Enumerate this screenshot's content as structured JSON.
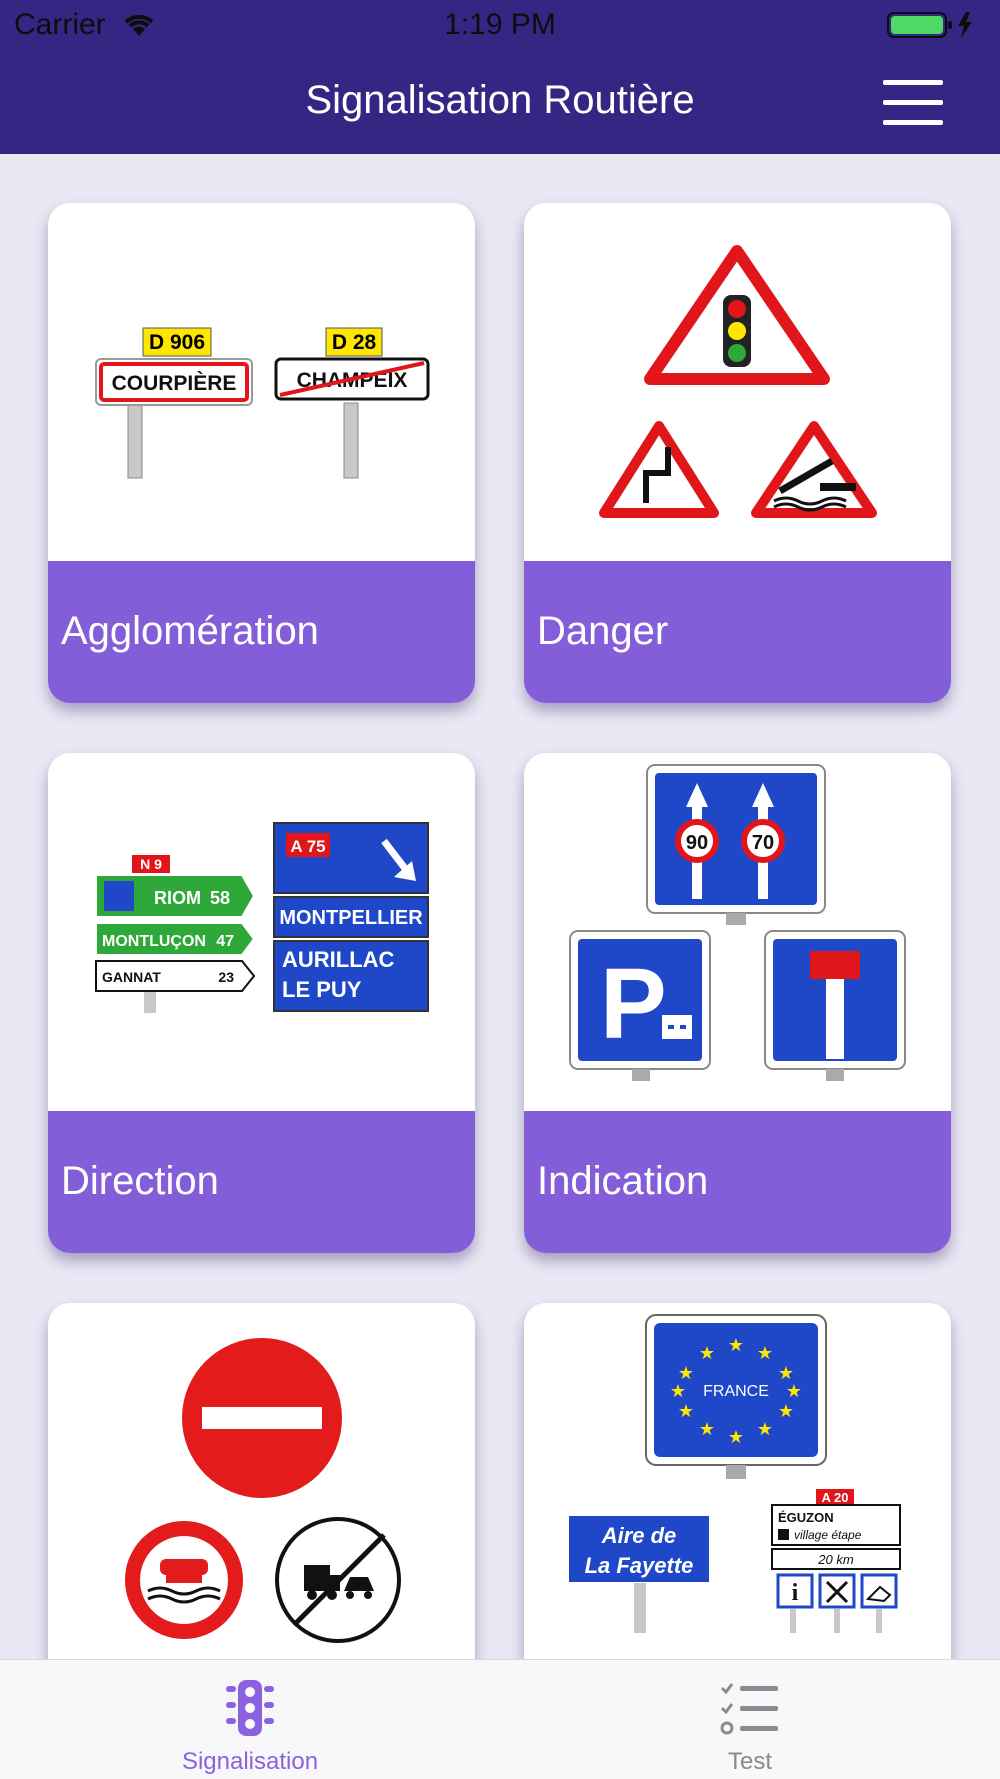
{
  "status_bar": {
    "carrier": "Carrier",
    "time": "1:19 PM"
  },
  "nav": {
    "title": "Signalisation Routière"
  },
  "cards": [
    {
      "label": "Agglomération"
    },
    {
      "label": "Danger"
    },
    {
      "label": "Direction"
    },
    {
      "label": "Indication"
    },
    {
      "label": ""
    },
    {
      "label": ""
    }
  ],
  "sign_text": {
    "agglo_road_1": "D 906",
    "agglo_town_1": "COURPIÈRE",
    "agglo_road_2": "D 28",
    "agglo_town_2": "CHAMPEIX",
    "dir_route": "N 9",
    "dir_city_1": "RIOM",
    "dir_dist_1": "58",
    "dir_city_2": "MONTLUÇON",
    "dir_dist_2": "47",
    "dir_city_3": "GANNAT",
    "dir_dist_3": "23",
    "dir_motorway": "A 75",
    "dir_city_4": "MONTPELLIER",
    "dir_city_5": "AURILLAC",
    "dir_city_6": "LE PUY",
    "ind_speed_1": "90",
    "ind_speed_2": "70",
    "loc_country": "FRANCE",
    "loc_aire_1": "Aire de",
    "loc_aire_2": "La Fayette",
    "loc_motorway": "A 20",
    "loc_town": "ÉGUZON",
    "loc_village": "village étape",
    "loc_distance": "20 km"
  },
  "tabs": [
    {
      "label": "Signalisation",
      "icon": "traffic-light-icon",
      "active": true
    },
    {
      "label": "Test",
      "icon": "checklist-icon",
      "active": false
    }
  ],
  "colors": {
    "nav_bg": "#342783",
    "card_label_bg": "#845ed8",
    "page_bg": "#eae8f5",
    "tab_active": "#8a62e0"
  }
}
